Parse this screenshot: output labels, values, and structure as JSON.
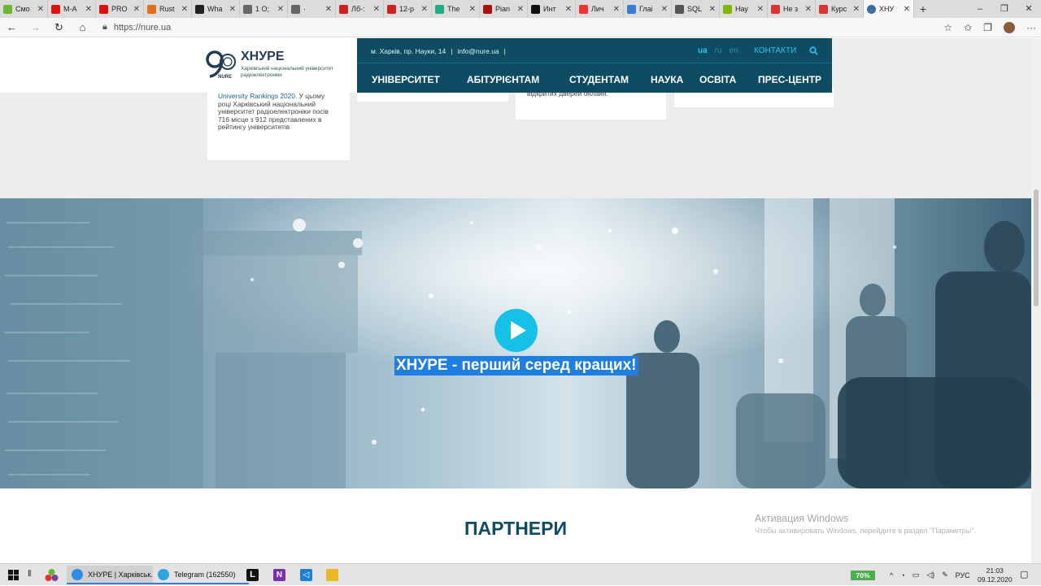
{
  "browser": {
    "tabs": [
      {
        "label": "Смо",
        "color": "#6cb52d"
      },
      {
        "label": "M-А",
        "color": "#d11"
      },
      {
        "label": "PRO",
        "color": "#d11"
      },
      {
        "label": "Rust",
        "color": "#e0701a"
      },
      {
        "label": "Wha",
        "color": "#222"
      },
      {
        "label": "1 О;",
        "color": "#666"
      },
      {
        "label": "·",
        "color": "#666"
      },
      {
        "label": "Лб-:",
        "color": "#c22"
      },
      {
        "label": "12-р",
        "color": "#c22"
      },
      {
        "label": "The",
        "color": "#2a8"
      },
      {
        "label": "Pian",
        "color": "#a11"
      },
      {
        "label": "Инт",
        "color": "#111"
      },
      {
        "label": "Лич",
        "color": "#e33"
      },
      {
        "label": "Глаі",
        "color": "#3a7bd5"
      },
      {
        "label": "SQL",
        "color": "#555"
      },
      {
        "label": "Нау",
        "color": "#7fb800"
      },
      {
        "label": "Не з",
        "color": "#d33"
      },
      {
        "label": "Курс",
        "color": "#d33"
      }
    ],
    "active_tab": {
      "label": "ХНУ",
      "color": "#3a6ea5"
    },
    "new_tab": "+",
    "url": "https://nure.ua",
    "window_controls": [
      "–",
      "❐",
      "✕"
    ]
  },
  "header": {
    "logo_title": "ХНУРЕ",
    "logo_subtitle": "Харківський національний університет радіоелектроніки",
    "address": "м. Харків, пр. Науки, 14",
    "email": "info@nure.ua",
    "langs": [
      "ua",
      "ru",
      "en"
    ],
    "contacts": "КОНТАКТИ",
    "nav": [
      "УНІВЕРСИТЕТ",
      "АБІТУРІЄНТАМ",
      "СТУДЕНТАМ",
      "НАУКА",
      "ОСВІТА",
      "ПРЕС-ЦЕНТР"
    ]
  },
  "cards": {
    "card1_highlight": "University Rankings 2020.",
    "card1_text": " У цьому році Харківський національний університет радіоелектроніки посів 716 місце з 912 представлених в рейтингу університетів",
    "card3_text": "відкритих дверей онлайн."
  },
  "hero": {
    "title": "ХНУРЕ - перший серед кращих!"
  },
  "partners": {
    "title": "ПАРТНЕРИ"
  },
  "watermark": {
    "line1": "Активация Windows",
    "line2": "Чтобы активировать Windows, перейдите в раздел \"Параметры\"."
  },
  "taskbar": {
    "apps": [
      {
        "label": "ХНУРЕ | Харківськ...",
        "color": "#2f8de0"
      },
      {
        "label": "Telegram (162550)",
        "color": "#2ca5e0"
      }
    ],
    "battery": "70%",
    "lang": "РУС",
    "time": "21:03",
    "date": "09.12.2020"
  }
}
